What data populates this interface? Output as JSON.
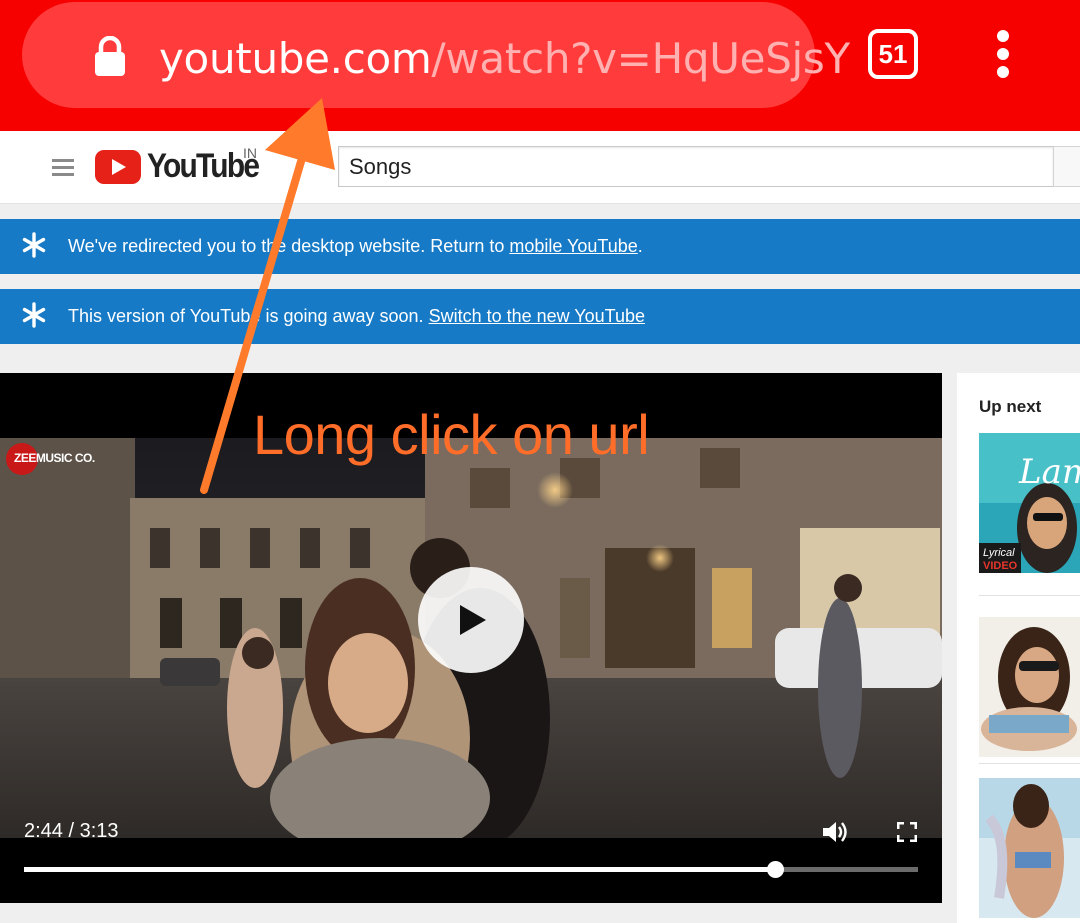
{
  "browser": {
    "url_domain": "youtube.com",
    "url_path": "/watch?v=HqUeSjsY",
    "tab_count": "51"
  },
  "masthead": {
    "logo_word": "YouTube",
    "country_code": "IN",
    "search_value": "Songs"
  },
  "alerts": [
    {
      "text": "We've redirected you to the desktop website. Return to ",
      "link": "mobile YouTube",
      "suffix": "."
    },
    {
      "text": "This version of YouTube is going away soon. ",
      "link": "Switch to the new YouTube",
      "suffix": ""
    }
  ],
  "player": {
    "channel_watermark": "ZEEMUSIC CO.",
    "time_display": "2:44 / 3:13",
    "progress_fraction": 0.84
  },
  "annotation": {
    "text": "Long click on url",
    "color": "#ff6d29"
  },
  "sidebar": {
    "title": "Up next",
    "thumb_1_caption_top": "Lyrical",
    "thumb_1_caption_bottom": "VIDEO",
    "thumb_1_overlay": "Lam"
  },
  "colors": {
    "browser_bar": "#f60000",
    "alert_blue": "#167ac6",
    "youtube_red": "#e62117"
  }
}
